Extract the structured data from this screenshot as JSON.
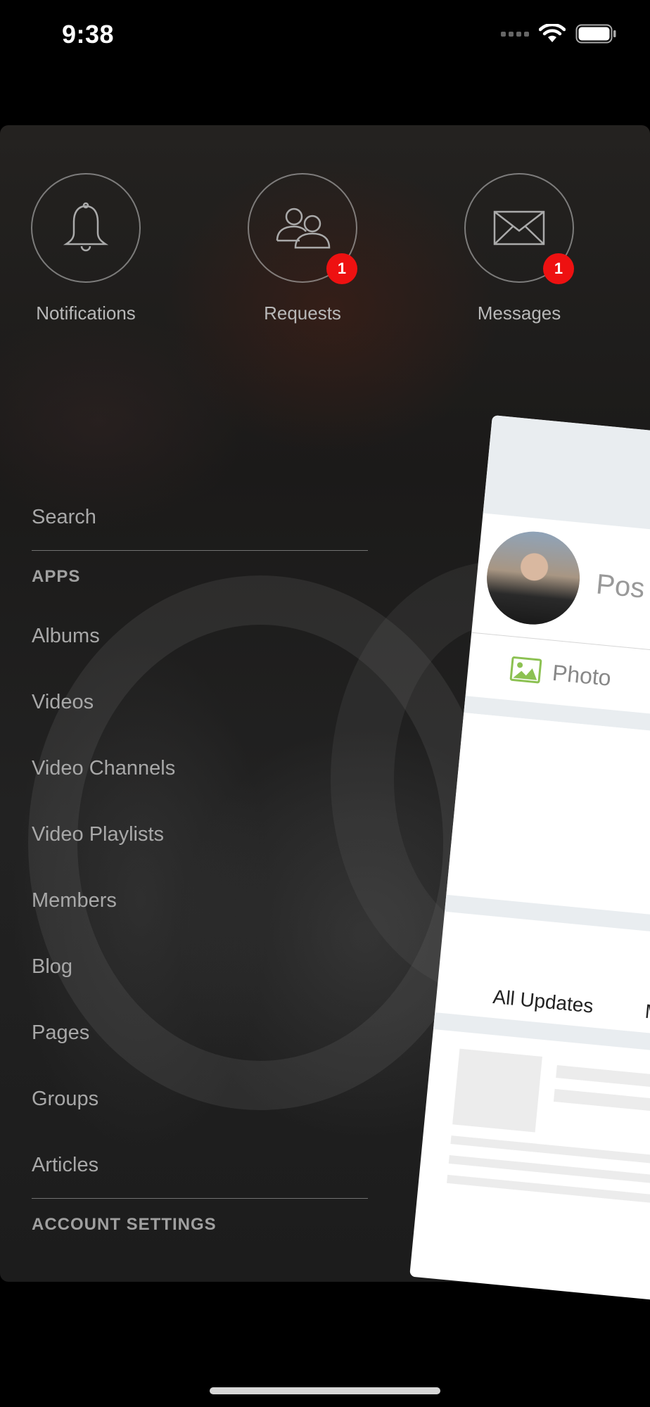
{
  "status_bar": {
    "time": "9:38",
    "icons": [
      "signal-icon",
      "wifi-icon",
      "battery-icon"
    ]
  },
  "quick_actions": [
    {
      "label": "Notifications",
      "icon": "bell-icon",
      "badge": ""
    },
    {
      "label": "Requests",
      "icon": "people-icon",
      "badge": "1"
    },
    {
      "label": "Messages",
      "icon": "envelope-icon",
      "badge": "1"
    }
  ],
  "menu": {
    "search": "Search",
    "apps_header": "APPS",
    "items": [
      "Albums",
      "Videos",
      "Video Channels",
      "Video Playlists",
      "Members",
      "Blog",
      "Pages",
      "Groups",
      "Articles"
    ],
    "account_header": "ACCOUNT SETTINGS"
  },
  "feed_preview": {
    "post_placeholder": "Pos",
    "photo_label": "Photo",
    "tabs": [
      "All Updates",
      "My Ne"
    ]
  },
  "colors": {
    "badge": "#ee1111",
    "photo_icon": "#8cc152",
    "menu_text": "#a8a8a8"
  }
}
